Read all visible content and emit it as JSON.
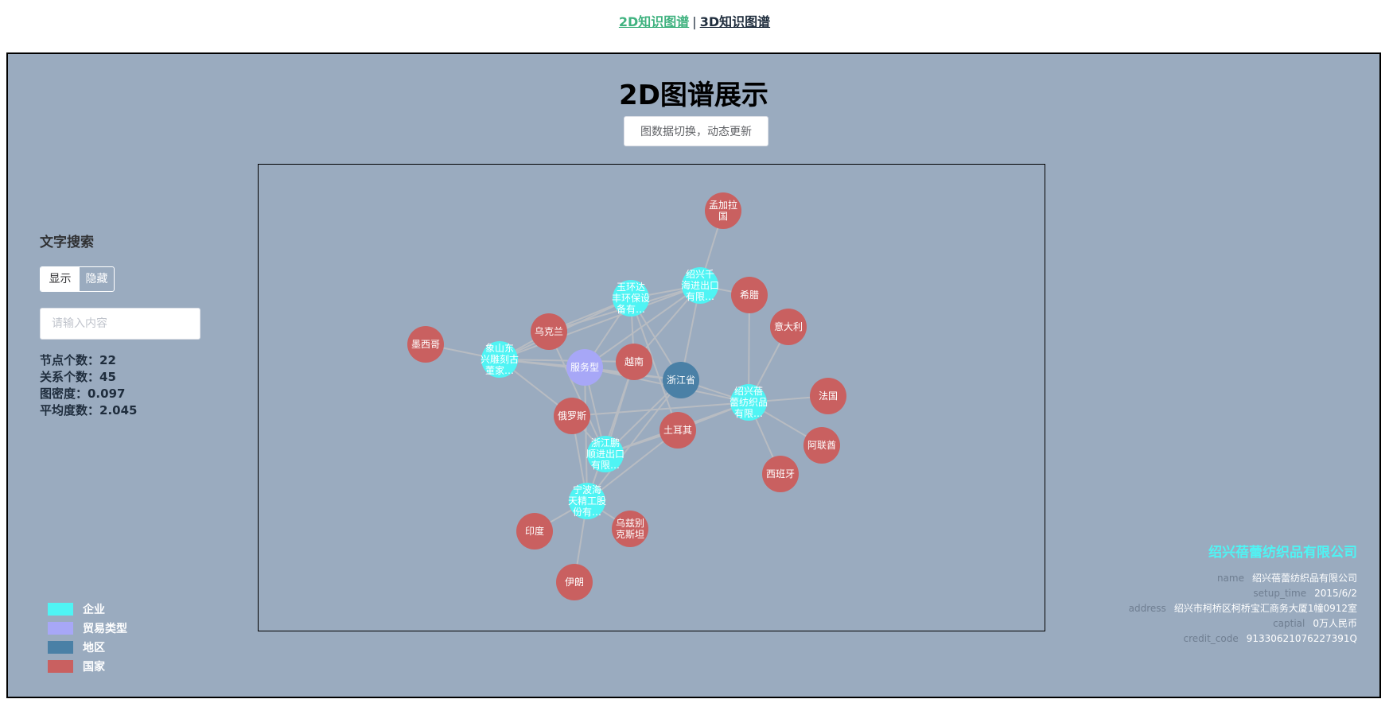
{
  "nav": {
    "tab_2d": "2D知识图谱",
    "separator": "|",
    "tab_3d": "3D知识图谱"
  },
  "panel": {
    "title": "2D图谱展示",
    "switch_button": "图数据切换，动态更新"
  },
  "search": {
    "title": "文字搜索",
    "show_label": "显示",
    "hide_label": "隐藏",
    "placeholder": "请输入内容",
    "value": ""
  },
  "stats": {
    "nodes": "节点个数：22",
    "relations": "关系个数：45",
    "density": "图密度：0.097",
    "avg_degree": "平均度数：2.045"
  },
  "legend": [
    {
      "label": "企业",
      "color": "#4ff4f4"
    },
    {
      "label": "贸易类型",
      "color": "#a7a7f7"
    },
    {
      "label": "地区",
      "color": "#4a80a6"
    },
    {
      "label": "国家",
      "color": "#c96060"
    }
  ],
  "colors": {
    "enterprise": "#4ff4f4",
    "trade": "#a7a7f7",
    "region": "#4a80a6",
    "country": "#c96060",
    "edge": "#b8bcc2",
    "panel_bg": "#9aabbf",
    "active_tab": "#3fb27f"
  },
  "graph": {
    "nodes": [
      {
        "id": "mjl",
        "label": [
          "孟加拉",
          "国"
        ],
        "type": "country"
      },
      {
        "id": "sxqh",
        "label": [
          "绍兴千",
          "海进出口",
          "有限…"
        ],
        "type": "enterprise"
      },
      {
        "id": "yhd",
        "label": [
          "玉环达",
          "丰环保设",
          "备有…"
        ],
        "type": "enterprise"
      },
      {
        "id": "xl",
        "label": [
          "希腊"
        ],
        "type": "country"
      },
      {
        "id": "ydl",
        "label": [
          "意大利"
        ],
        "type": "country"
      },
      {
        "id": "wkl",
        "label": [
          "乌克兰"
        ],
        "type": "country"
      },
      {
        "id": "mxg",
        "label": [
          "墨西哥"
        ],
        "type": "country"
      },
      {
        "id": "xsd",
        "label": [
          "象山东",
          "兴雕刻古",
          "董家…"
        ],
        "type": "enterprise"
      },
      {
        "id": "fwx",
        "label": [
          "服务型"
        ],
        "type": "trade"
      },
      {
        "id": "yn",
        "label": [
          "越南"
        ],
        "type": "country"
      },
      {
        "id": "zjs",
        "label": [
          "浙江省"
        ],
        "type": "region"
      },
      {
        "id": "sxb",
        "label": [
          "绍兴蓓",
          "蕾纺织品",
          "有限…"
        ],
        "type": "enterprise"
      },
      {
        "id": "fg",
        "label": [
          "法国"
        ],
        "type": "country"
      },
      {
        "id": "els",
        "label": [
          "俄罗斯"
        ],
        "type": "country"
      },
      {
        "id": "teq",
        "label": [
          "土耳其"
        ],
        "type": "country"
      },
      {
        "id": "zjp",
        "label": [
          "浙江鹏",
          "顺进出口",
          "有限…"
        ],
        "type": "enterprise"
      },
      {
        "id": "alq",
        "label": [
          "阿联酋"
        ],
        "type": "country"
      },
      {
        "id": "xby",
        "label": [
          "西班牙"
        ],
        "type": "country"
      },
      {
        "id": "nbh",
        "label": [
          "宁波海",
          "天精工股",
          "份有…"
        ],
        "type": "enterprise"
      },
      {
        "id": "yd",
        "label": [
          "印度"
        ],
        "type": "country"
      },
      {
        "id": "wzb",
        "label": [
          "乌兹别",
          "克斯坦"
        ],
        "type": "country"
      },
      {
        "id": "yl",
        "label": [
          "伊朗"
        ],
        "type": "country"
      }
    ],
    "edges": [
      [
        "sxqh",
        "mjl"
      ],
      [
        "sxqh",
        "xl"
      ],
      [
        "sxqh",
        "yhd"
      ],
      [
        "sxqh",
        "fwx"
      ],
      [
        "sxqh",
        "zjs"
      ],
      [
        "sxqh",
        "yn"
      ],
      [
        "sxqh",
        "wkl"
      ],
      [
        "sxqh",
        "xsd"
      ],
      [
        "yhd",
        "wkl"
      ],
      [
        "yhd",
        "fwx"
      ],
      [
        "yhd",
        "yn"
      ],
      [
        "yhd",
        "zjs"
      ],
      [
        "yhd",
        "xsd"
      ],
      [
        "yhd",
        "teq"
      ],
      [
        "xsd",
        "mxg"
      ],
      [
        "xsd",
        "fwx"
      ],
      [
        "xsd",
        "zjs"
      ],
      [
        "xsd",
        "wkl"
      ],
      [
        "xsd",
        "els"
      ],
      [
        "xsd",
        "yn"
      ],
      [
        "sxb",
        "fwx"
      ],
      [
        "sxb",
        "zjs"
      ],
      [
        "sxb",
        "ydl"
      ],
      [
        "sxb",
        "xl"
      ],
      [
        "sxb",
        "fg"
      ],
      [
        "sxb",
        "alq"
      ],
      [
        "sxb",
        "xby"
      ],
      [
        "sxb",
        "teq"
      ],
      [
        "sxb",
        "els"
      ],
      [
        "sxb",
        "zjp"
      ],
      [
        "zjp",
        "fwx"
      ],
      [
        "zjp",
        "zjs"
      ],
      [
        "zjp",
        "els"
      ],
      [
        "zjp",
        "teq"
      ],
      [
        "zjp",
        "yn"
      ],
      [
        "zjp",
        "wkl"
      ],
      [
        "nbh",
        "fwx"
      ],
      [
        "nbh",
        "zjs"
      ],
      [
        "nbh",
        "yd"
      ],
      [
        "nbh",
        "wzb"
      ],
      [
        "nbh",
        "yl"
      ],
      [
        "nbh",
        "els"
      ],
      [
        "nbh",
        "teq"
      ],
      [
        "nbh",
        "yn"
      ],
      [
        "fwx",
        "zjs"
      ]
    ]
  },
  "info": {
    "title": "绍兴蓓蕾纺织品有限公司",
    "rows": [
      {
        "key": "name",
        "value": "绍兴蓓蕾纺织品有限公司"
      },
      {
        "key": "setup_time",
        "value": "2015/6/2"
      },
      {
        "key": "address",
        "value": "绍兴市柯桥区柯桥宝汇商务大厦1幢0912室"
      },
      {
        "key": "captial",
        "value": "0万人民币"
      },
      {
        "key": "credit_code",
        "value": "91330621076227391Q"
      }
    ]
  }
}
